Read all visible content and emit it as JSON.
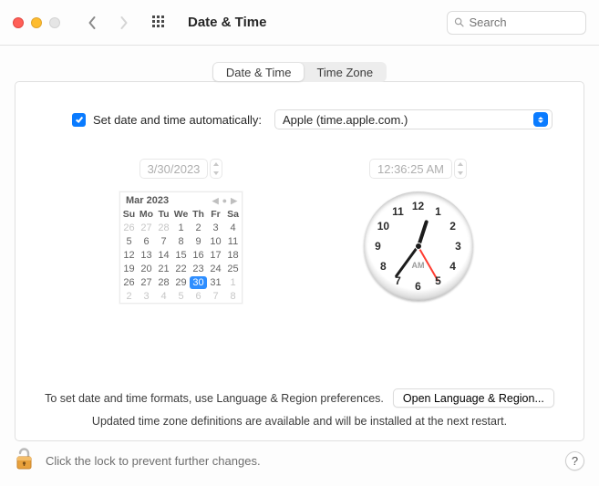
{
  "window": {
    "title": "Date & Time"
  },
  "search": {
    "placeholder": "Search"
  },
  "tabs": {
    "date_time": "Date & Time",
    "time_zone": "Time Zone",
    "active": "date_time"
  },
  "autoset": {
    "checked": true,
    "label": "Set date and time automatically:",
    "server": "Apple (time.apple.com.)"
  },
  "date_field": "3/30/2023",
  "time_field": "12:36:25 AM",
  "calendar": {
    "title": "Mar 2023",
    "dow": [
      "Su",
      "Mo",
      "Tu",
      "We",
      "Th",
      "Fr",
      "Sa"
    ],
    "weeks": [
      [
        {
          "d": "26",
          "dim": true
        },
        {
          "d": "27",
          "dim": true
        },
        {
          "d": "28",
          "dim": true
        },
        {
          "d": "1"
        },
        {
          "d": "2"
        },
        {
          "d": "3"
        },
        {
          "d": "4"
        }
      ],
      [
        {
          "d": "5"
        },
        {
          "d": "6"
        },
        {
          "d": "7"
        },
        {
          "d": "8"
        },
        {
          "d": "9"
        },
        {
          "d": "10"
        },
        {
          "d": "11"
        }
      ],
      [
        {
          "d": "12"
        },
        {
          "d": "13"
        },
        {
          "d": "14"
        },
        {
          "d": "15"
        },
        {
          "d": "16"
        },
        {
          "d": "17"
        },
        {
          "d": "18"
        }
      ],
      [
        {
          "d": "19"
        },
        {
          "d": "20"
        },
        {
          "d": "21"
        },
        {
          "d": "22"
        },
        {
          "d": "23"
        },
        {
          "d": "24"
        },
        {
          "d": "25"
        }
      ],
      [
        {
          "d": "26"
        },
        {
          "d": "27"
        },
        {
          "d": "28"
        },
        {
          "d": "29"
        },
        {
          "d": "30",
          "sel": true
        },
        {
          "d": "31"
        },
        {
          "d": "1",
          "dim": true
        }
      ],
      [
        {
          "d": "2",
          "dim": true
        },
        {
          "d": "3",
          "dim": true
        },
        {
          "d": "4",
          "dim": true
        },
        {
          "d": "5",
          "dim": true
        },
        {
          "d": "6",
          "dim": true
        },
        {
          "d": "7",
          "dim": true
        },
        {
          "d": "8",
          "dim": true
        }
      ]
    ]
  },
  "clock": {
    "hours": 12,
    "minutes": 36,
    "seconds": 25,
    "ampm": "AM"
  },
  "notes": {
    "formats": "To set date and time formats, use Language & Region preferences.",
    "open_button": "Open Language & Region...",
    "tz_update": "Updated time zone definitions are available and will be installed at the next restart."
  },
  "footer": {
    "lock_text": "Click the lock to prevent further changes."
  }
}
